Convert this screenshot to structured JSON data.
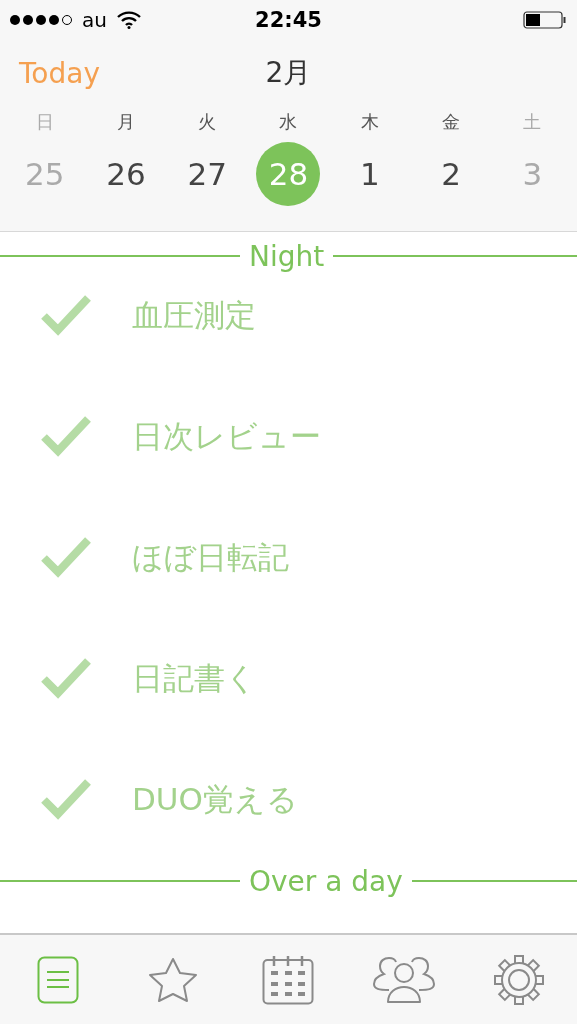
{
  "status_bar": {
    "carrier": "au",
    "time": "22:45"
  },
  "header": {
    "today_button": "Today",
    "month": "2月"
  },
  "weekdays": [
    {
      "label": "日",
      "weekend": true
    },
    {
      "label": "月",
      "weekend": false
    },
    {
      "label": "火",
      "weekend": false
    },
    {
      "label": "水",
      "weekend": false
    },
    {
      "label": "木",
      "weekend": false
    },
    {
      "label": "金",
      "weekend": false
    },
    {
      "label": "土",
      "weekend": true
    }
  ],
  "dates": [
    {
      "label": "25",
      "weekend": true,
      "selected": false
    },
    {
      "label": "26",
      "weekend": false,
      "selected": false
    },
    {
      "label": "27",
      "weekend": false,
      "selected": false
    },
    {
      "label": "28",
      "weekend": false,
      "selected": true
    },
    {
      "label": "1",
      "weekend": false,
      "selected": false
    },
    {
      "label": "2",
      "weekend": false,
      "selected": false
    },
    {
      "label": "3",
      "weekend": true,
      "selected": false
    }
  ],
  "sections": [
    {
      "title": "Night",
      "tasks": [
        {
          "label": "血圧測定",
          "done": true
        },
        {
          "label": "日次レビュー",
          "done": true
        },
        {
          "label": "ほぼ日転記",
          "done": true
        },
        {
          "label": "日記書く",
          "done": true
        },
        {
          "label": "DUO覚える",
          "done": true
        }
      ]
    },
    {
      "title": "Over a day"
    }
  ],
  "tab_bar": [
    {
      "kind": "list",
      "selected": true
    },
    {
      "kind": "star",
      "selected": false
    },
    {
      "kind": "calendar",
      "selected": false
    },
    {
      "kind": "people",
      "selected": false
    },
    {
      "kind": "gear",
      "selected": false
    }
  ]
}
